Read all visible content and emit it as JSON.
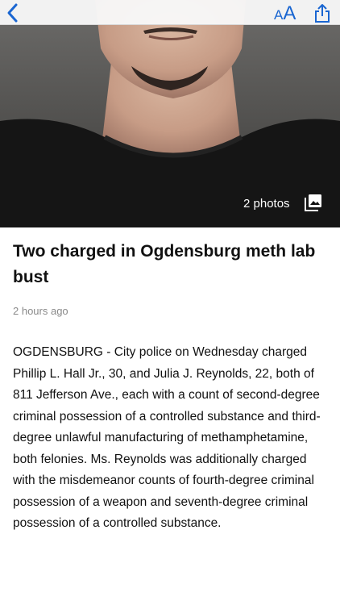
{
  "nav": {
    "text_size_small": "A",
    "text_size_large": "A"
  },
  "hero": {
    "photo_count_label": "2 photos"
  },
  "article": {
    "headline": "Two charged in Ogdensburg meth lab bust",
    "timestamp": "2 hours ago",
    "body": "OGDENSBURG - City police on Wednesday charged Phillip L. Hall Jr., 30, and Julia J. Reynolds, 22, both of 811 Jefferson Ave., each with a count of second-degree criminal possession of a controlled substance and third-degree unlawful manufacturing of methamphetamine, both felonies. Ms. Reynolds was additionally charged with the misdemeanor counts of fourth-degree criminal possession of a weapon and seventh-degree criminal possession of a controlled substance."
  },
  "colors": {
    "accent": "#1a66d1",
    "toolbar_bg": "#f8f8f8",
    "timestamp": "#8a8a8a"
  },
  "icons": {
    "back": "chevron-left-icon",
    "text_size": "text-size-icon",
    "share": "share-icon",
    "gallery": "photo-gallery-icon"
  }
}
